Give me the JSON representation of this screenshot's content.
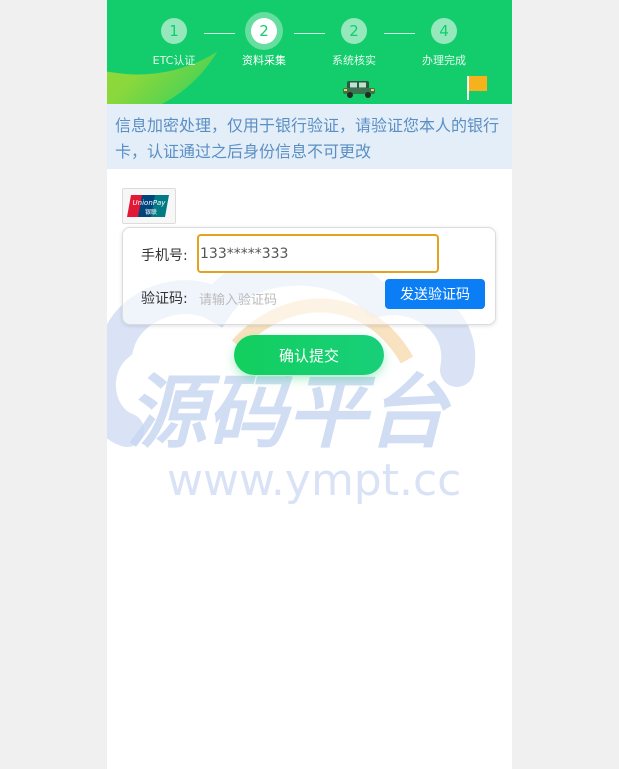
{
  "colors": {
    "header_green": "#13cd6c",
    "accent_yellow": "#c4e22a",
    "notice_bg": "#e3eef8",
    "notice_text": "#5b8fc4",
    "send_blue": "#0b7ef5",
    "input_border": "#e2a320"
  },
  "steps": [
    {
      "number": "1",
      "label": "ETC认证",
      "active": false
    },
    {
      "number": "2",
      "label": "资料采集",
      "active": true
    },
    {
      "number": "2",
      "label": "系统核实",
      "active": false
    },
    {
      "number": "4",
      "label": "办理完成",
      "active": false
    }
  ],
  "header": {
    "car_icon": "car-icon",
    "flag_icon": "flag-icon"
  },
  "notice": {
    "text": "信息加密处理，仅用于银行验证，请验证您本人的银行卡，认证通过之后身份信息不可更改"
  },
  "card": {
    "logo_icon": "unionpay-logo",
    "logo_text_top": "UnionPay",
    "logo_text_bottom": "银联"
  },
  "form": {
    "phone_label": "手机号:",
    "phone_value": "133*****333",
    "code_label": "验证码:",
    "code_placeholder": "请输入验证码",
    "send_code_label": "发送验证码"
  },
  "submit": {
    "label": "确认提交"
  },
  "watermark": {
    "title": "源码平台",
    "url": "www.ympt.cc"
  }
}
